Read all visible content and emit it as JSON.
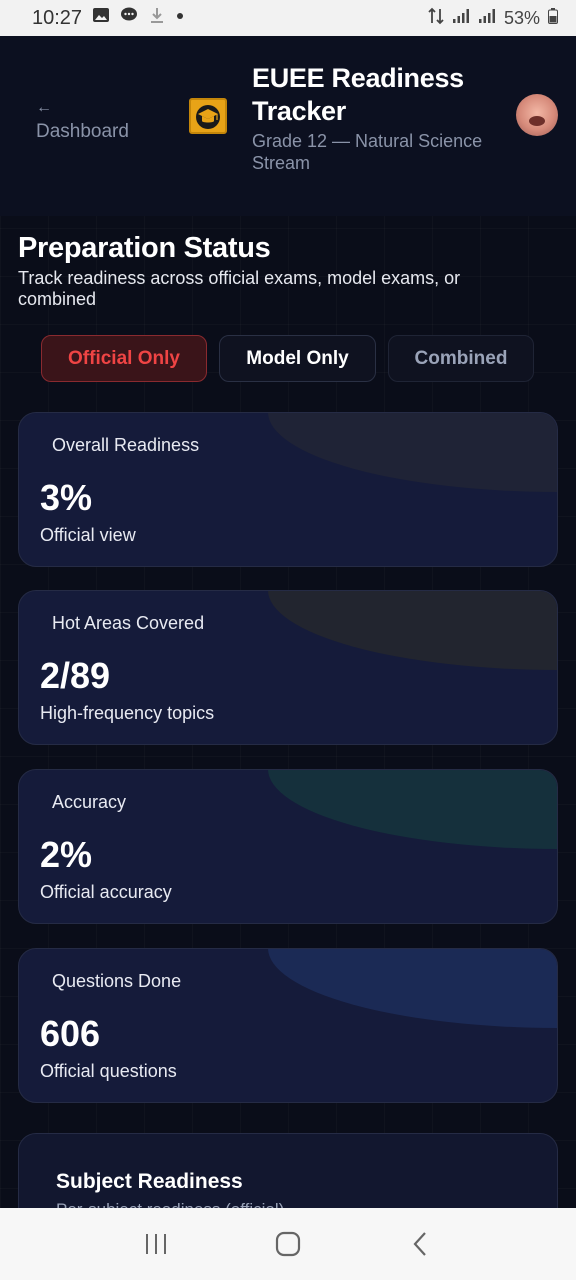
{
  "status_bar": {
    "time": "10:27",
    "battery": "53%",
    "icons": [
      "gallery-icon",
      "chat-icon",
      "download-icon",
      "dot-icon",
      "data-icon",
      "signal-icon",
      "signal-icon",
      "battery-icon"
    ]
  },
  "header": {
    "back_arrow": "←",
    "back_label": "Dashboard",
    "title": "EUEE Readiness Tracker",
    "subtitle": "Grade 12 — Natural Science Stream"
  },
  "section": {
    "title": "Preparation Status",
    "subtitle": "Track readiness across official exams, model exams, or combined"
  },
  "tabs": [
    {
      "label": "Official Only",
      "active": true
    },
    {
      "label": "Model Only",
      "active": false
    },
    {
      "label": "Combined",
      "active": false
    }
  ],
  "cards": [
    {
      "label": "Overall Readiness",
      "value": "3%",
      "desc": "Official view",
      "deco_color": "#1f2336"
    },
    {
      "label": "Hot Areas Covered",
      "value": "2/89",
      "desc": "High-frequency topics",
      "deco_color": "#22252f"
    },
    {
      "label": "Accuracy",
      "value": "2%",
      "desc": "Official accuracy",
      "deco_color": "#15303c"
    },
    {
      "label": "Questions Done",
      "value": "606",
      "desc": "Official questions",
      "deco_color": "#1b2a55"
    }
  ],
  "subject_card": {
    "title": "Subject Readiness",
    "subtitle": "Per-subject readiness (official)"
  },
  "colors": {
    "accent_red": "#ef4444",
    "background": "#0a0d19",
    "card_bg": "#151b3a",
    "logo": "#e8a317"
  }
}
